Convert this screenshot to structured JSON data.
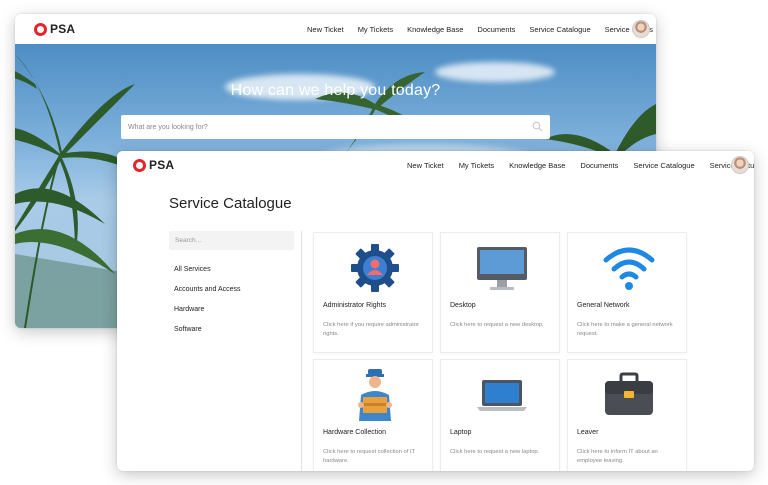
{
  "brand": {
    "logo_text": "PSA",
    "accent": "#e5242b"
  },
  "nav": [
    "New Ticket",
    "My Tickets",
    "Knowledge Base",
    "Documents",
    "Service Catalogue",
    "Service Status"
  ],
  "hero": {
    "title": "How can we help you today?",
    "search_placeholder": "What are you looking for?"
  },
  "catalogue": {
    "title": "Service Catalogue",
    "search_placeholder": "Search...",
    "categories": [
      "All Services",
      "Accounts and Access",
      "Hardware",
      "Software"
    ],
    "cards": [
      {
        "title": "Administrator Rights",
        "desc": "Click here if you require administrator rights.",
        "icon": "gear-user-icon"
      },
      {
        "title": "Desktop",
        "desc": "Click here to request a new desktop.",
        "icon": "desktop-icon"
      },
      {
        "title": "General Network",
        "desc": "Click here to make a general network request.",
        "icon": "wifi-icon"
      },
      {
        "title": "Hardware Collection",
        "desc": "Click here to request collection of IT hardware.",
        "icon": "delivery-person-icon"
      },
      {
        "title": "Laptop",
        "desc": "Click here to request a new laptop.",
        "icon": "laptop-icon"
      },
      {
        "title": "Leaver",
        "desc": "Click here to inform IT about an employee leaving.",
        "icon": "briefcase-icon"
      }
    ]
  }
}
